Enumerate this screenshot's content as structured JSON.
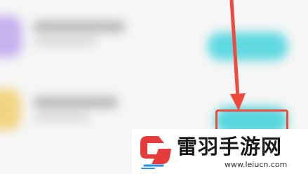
{
  "watermark": {
    "brand_name": "雷羽手游网",
    "url": "www.leiucn.com"
  },
  "colors": {
    "annotation": "#ee4b3f",
    "button": "#5fd9e0",
    "logo_red": "#e63b3b",
    "logo_blue": "#2b8de0"
  },
  "icons": {
    "arrow": "arrow-down-icon",
    "logo": "leiyu-logo-icon"
  }
}
